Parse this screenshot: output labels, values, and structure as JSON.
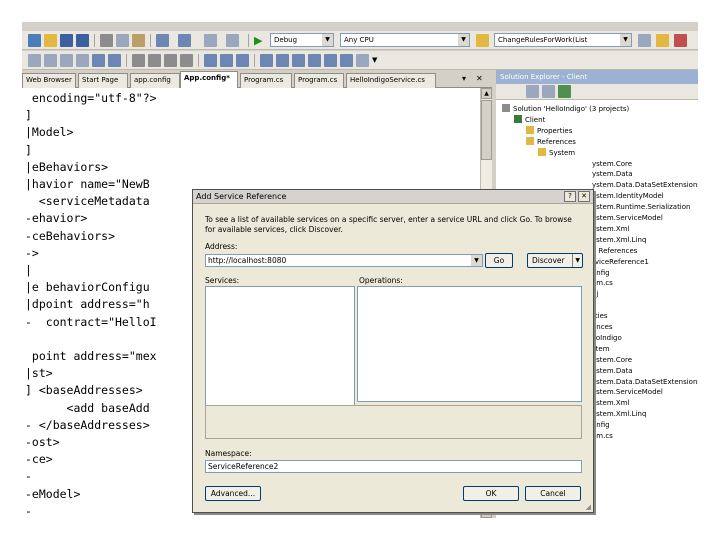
{
  "toolbar": {
    "config_combo": "Debug",
    "platform_combo": "Any CPU",
    "find_combo": "ChangeRulesForWork(List"
  },
  "tabs": [
    {
      "label": "Web Browser",
      "active": false
    },
    {
      "label": "Start Page",
      "active": false
    },
    {
      "label": "app.config",
      "active": false
    },
    {
      "label": "App.config*",
      "active": true
    },
    {
      "label": "Program.cs",
      "active": false
    },
    {
      "label": "Program.cs",
      "active": false
    },
    {
      "label": "HelloIndigoService.cs",
      "active": false
    }
  ],
  "tab_controls": {
    "dropdown": "▾",
    "close": "✕"
  },
  "editor": {
    "lines": [
      " encoding=\"utf-8\"?>",
      "]",
      "|Model>",
      "]",
      "|eBehaviors>",
      "|havior name=\"NewB",
      "  <serviceMetadata",
      "-ehavior>",
      "-ceBehaviors>",
      "->",
      "|",
      "|e behaviorConfigu",
      "|dpoint address=\"h",
      "-  contract=\"HelloI",
      "",
      " point address=\"mex",
      "|st>",
      "] <baseAddresses>",
      "      <add baseAdd",
      "- </baseAddresses>",
      "-ost>",
      "-ce>",
      "-",
      "-eModel>",
      "-"
    ]
  },
  "solution_explorer": {
    "title": "Solution Explorer - Client",
    "items": [
      {
        "label": "Solution 'HelloIndigo' (3 projects)",
        "indent": 0
      },
      {
        "label": "Client",
        "indent": 1
      },
      {
        "label": "Properties",
        "indent": 2
      },
      {
        "label": "References",
        "indent": 2
      },
      {
        "label": "System",
        "indent": 3
      },
      {
        "label": "ystem.Core",
        "indent": 4
      },
      {
        "label": "ystem.Data",
        "indent": 4
      },
      {
        "label": "ystem.Data.DataSetExtensions",
        "indent": 4
      },
      {
        "label": "ystem.IdentityModel",
        "indent": 4
      },
      {
        "label": "ystem.Runtime.Serialization",
        "indent": 4
      },
      {
        "label": "ystem.ServiceModel",
        "indent": 4
      },
      {
        "label": "ystem.Xml",
        "indent": 4
      },
      {
        "label": "ystem.Xml.Linq",
        "indent": 4
      },
      {
        "label": "e References",
        "indent": 4
      },
      {
        "label": "rviceReference1",
        "indent": 4
      },
      {
        "label": "onfig",
        "indent": 4
      },
      {
        "label": "am.cs",
        "indent": 4
      },
      {
        "label": "nj",
        "indent": 4
      },
      {
        "label": "",
        "indent": 4
      },
      {
        "label": "rties",
        "indent": 4
      },
      {
        "label": "ences",
        "indent": 4
      },
      {
        "label": "lloIndigo",
        "indent": 4
      },
      {
        "label": "stem",
        "indent": 4
      },
      {
        "label": "ystem.Core",
        "indent": 4
      },
      {
        "label": "ystem.Data",
        "indent": 4
      },
      {
        "label": "ystem.Data.DataSetExtensions",
        "indent": 4
      },
      {
        "label": "ystem.ServiceModel",
        "indent": 4
      },
      {
        "label": "ystem.Xml",
        "indent": 4
      },
      {
        "label": "ystem.Xml.Linq",
        "indent": 4
      },
      {
        "label": "onfig",
        "indent": 4
      },
      {
        "label": "am.cs",
        "indent": 4
      }
    ]
  },
  "dialog": {
    "title": "Add Service Reference",
    "help_button": "?",
    "close_button": "✕",
    "description": "To see a list of available services on a specific server, enter a service URL and click Go. To browse for available services, click Discover.",
    "address_label": "Address:",
    "address_value": "http://localhost:8080",
    "go_button": "Go",
    "discover_button": "Discover",
    "services_label": "Services:",
    "operations_label": "Operations:",
    "namespace_label": "Namespace:",
    "namespace_value": "ServiceReference2",
    "advanced_button": "Advanced...",
    "ok_button": "OK",
    "cancel_button": "Cancel"
  }
}
